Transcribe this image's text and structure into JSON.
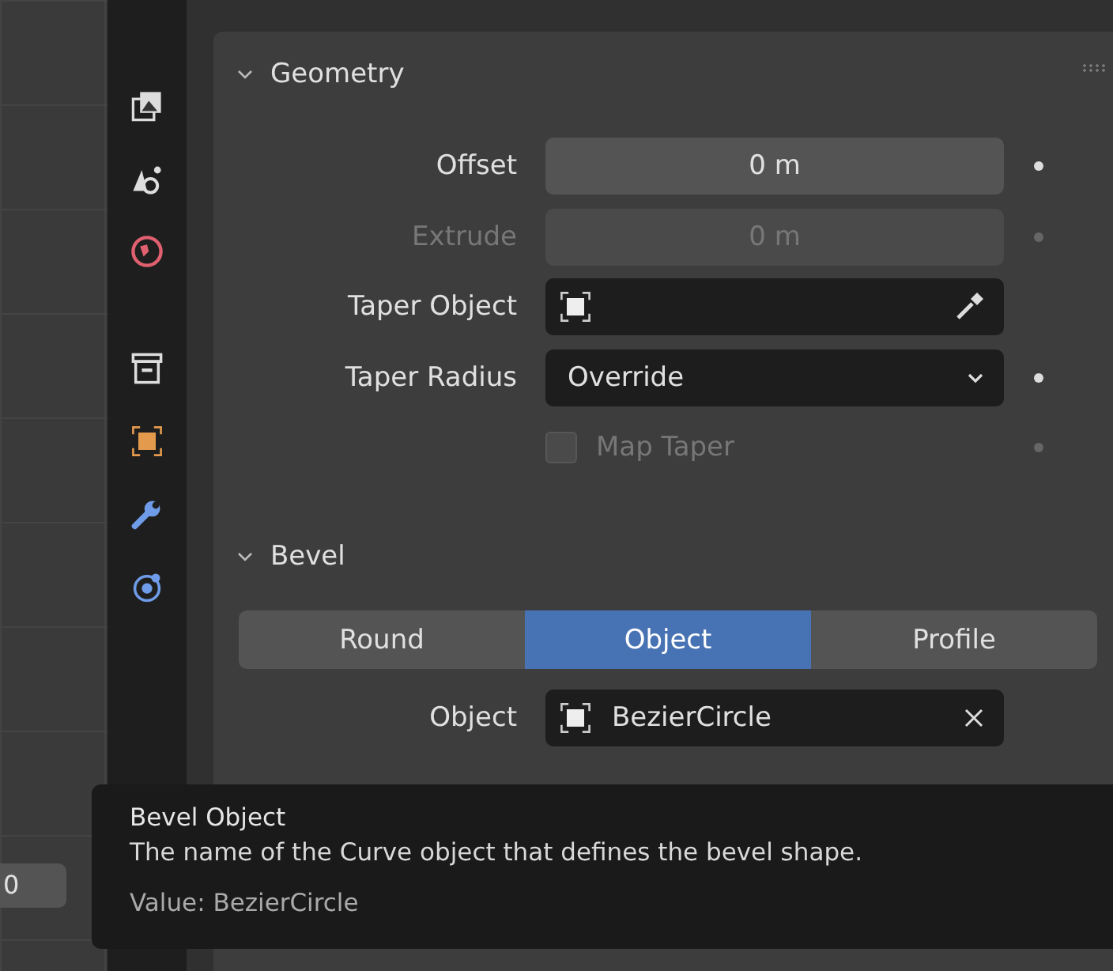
{
  "viewport": {
    "field_value": "0"
  },
  "geometry": {
    "title": "Geometry",
    "expanded": true,
    "rows": [
      {
        "kind": "number",
        "label": "Offset",
        "value": "0 m",
        "disabled": false
      },
      {
        "kind": "number",
        "label": "Extrude",
        "value": "0 m",
        "disabled": true
      },
      {
        "kind": "object",
        "label": "Taper Object",
        "disabled": false
      },
      {
        "kind": "dropdown",
        "label": "Taper Radius",
        "value": "Override",
        "disabled": false
      },
      {
        "kind": "checkbox",
        "label": "Map Taper",
        "checked": false,
        "disabled": true
      }
    ]
  },
  "bevel": {
    "title": "Bevel",
    "expanded": true,
    "modes": [
      {
        "label": "Round",
        "selected": false
      },
      {
        "label": "Object",
        "selected": true
      },
      {
        "label": "Profile",
        "selected": false
      }
    ],
    "rows": [
      {
        "kind": "object",
        "label": "Object",
        "value": "BezierCircle",
        "disabled": false
      }
    ]
  },
  "tooltip": {
    "title": "Bevel Object",
    "description": "The name of the Curve object that defines the bevel shape.",
    "value": "Value: BezierCircle"
  }
}
